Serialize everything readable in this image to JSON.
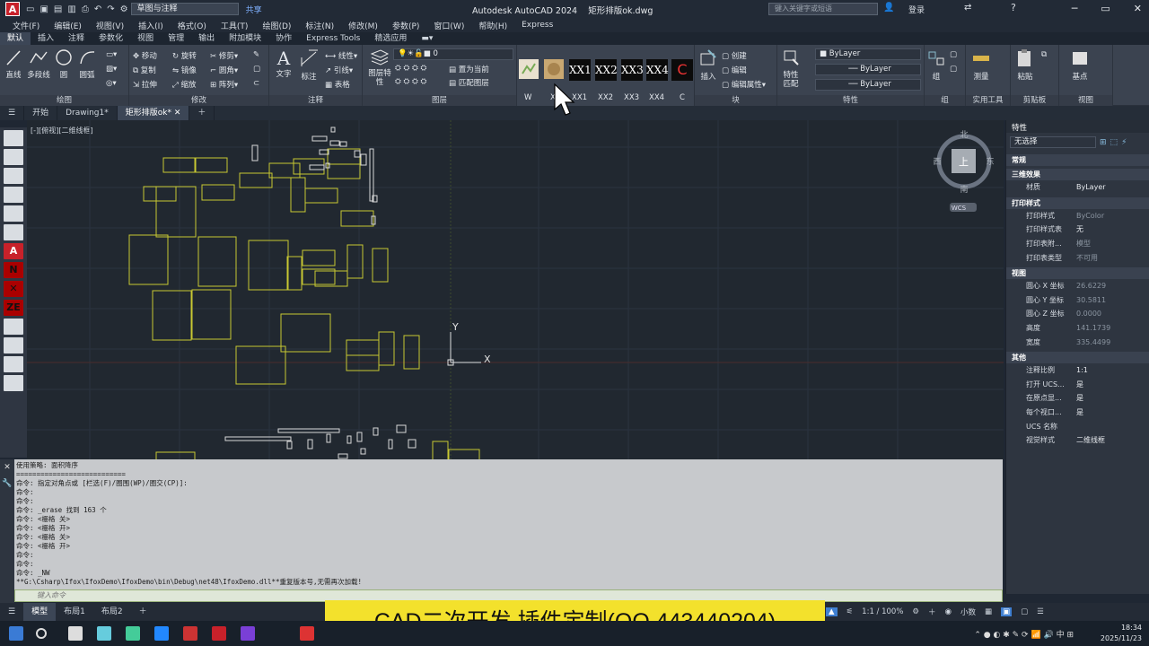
{
  "titlebar": {
    "workspace": "草图与注释",
    "share": "共享",
    "app_title": "Autodesk AutoCAD 2024",
    "file_name": "矩形排版ok.dwg",
    "search_placeholder": "键入关键字或短语",
    "login": "登录"
  },
  "menu": [
    "文件(F)",
    "编辑(E)",
    "视图(V)",
    "插入(I)",
    "格式(O)",
    "工具(T)",
    "绘图(D)",
    "标注(N)",
    "修改(M)",
    "参数(P)",
    "窗口(W)",
    "帮助(H)",
    "Express"
  ],
  "ribbon_tabs": [
    "默认",
    "插入",
    "注释",
    "参数化",
    "视图",
    "管理",
    "输出",
    "附加模块",
    "协作",
    "Express Tools",
    "精选应用"
  ],
  "ribbon": {
    "draw": {
      "label": "绘图",
      "buttons": [
        "直线",
        "多段线",
        "圆",
        "圆弧"
      ]
    },
    "modify": {
      "label": "修改",
      "buttons": [
        "移动",
        "旋转",
        "修剪",
        "复制",
        "镜像",
        "圆角",
        "拉伸",
        "缩放",
        "阵列"
      ]
    },
    "annotation": {
      "label": "注释",
      "buttons": [
        "文字",
        "标注",
        "线性",
        "引线",
        "表格"
      ]
    },
    "layers": {
      "label": "图层",
      "buttons": [
        "图层特性",
        "置为当前",
        "匹配图层"
      ],
      "current_layer": "0"
    },
    "custom": {
      "labels": [
        "W",
        "X",
        "XX1",
        "XX2",
        "XX3",
        "XX4",
        "C"
      ],
      "boxes": [
        "XX1",
        "XX2",
        "XX3",
        "XX4"
      ]
    },
    "block": {
      "label": "块",
      "buttons": [
        "插入",
        "创建",
        "编辑",
        "编辑属性"
      ]
    },
    "properties": {
      "label": "特性",
      "match": "特性匹配",
      "color": "ByLayer",
      "linetype": "ByLayer",
      "lineweight": "ByLayer"
    },
    "groups": {
      "label": "组",
      "buttons": [
        "组"
      ]
    },
    "utilities": {
      "label": "实用工具",
      "buttons": [
        "测量"
      ]
    },
    "clipboard": {
      "label": "剪贴板",
      "buttons": [
        "粘贴"
      ]
    },
    "view": {
      "label": "视图",
      "buttons": [
        "基点"
      ]
    }
  },
  "doc_tabs": [
    "开始",
    "Drawing1*",
    "矩形排版ok*"
  ],
  "viewport": {
    "label": "[-][俯视][二维线框]",
    "compass": {
      "n": "北",
      "s": "南",
      "e": "东",
      "w": "西",
      "top": "上",
      "wcs": "WCS"
    },
    "ucs_x": "X",
    "ucs_y": "Y"
  },
  "properties": {
    "title": "特性",
    "selection": "无选择",
    "sections": [
      {
        "name": "常规",
        "rows": []
      },
      {
        "name": "三维效果",
        "rows": [
          {
            "k": "材质",
            "v": "ByLayer",
            "dim": false
          }
        ]
      },
      {
        "name": "打印样式",
        "rows": [
          {
            "k": "打印样式",
            "v": "ByColor",
            "dim": true
          },
          {
            "k": "打印样式表",
            "v": "无",
            "dim": false
          },
          {
            "k": "打印表附...",
            "v": "模型",
            "dim": true
          },
          {
            "k": "打印表类型",
            "v": "不可用",
            "dim": true
          }
        ]
      },
      {
        "name": "视图",
        "rows": [
          {
            "k": "圆心 X 坐标",
            "v": "26.6229",
            "dim": true
          },
          {
            "k": "圆心 Y 坐标",
            "v": "30.5811",
            "dim": true
          },
          {
            "k": "圆心 Z 坐标",
            "v": "0.0000",
            "dim": true
          },
          {
            "k": "高度",
            "v": "141.1739",
            "dim": true
          },
          {
            "k": "宽度",
            "v": "335.4499",
            "dim": true
          }
        ]
      },
      {
        "name": "其他",
        "rows": [
          {
            "k": "注释比例",
            "v": "1:1",
            "dim": false
          },
          {
            "k": "打开 UCS...",
            "v": "是",
            "dim": false
          },
          {
            "k": "在原点显...",
            "v": "是",
            "dim": false
          },
          {
            "k": "每个视口...",
            "v": "是",
            "dim": false
          },
          {
            "k": "UCS 名称",
            "v": "",
            "dim": false
          },
          {
            "k": "视觉样式",
            "v": "二维线框",
            "dim": false
          }
        ]
      }
    ]
  },
  "command": {
    "lines": [
      "使用策略: 面积降序",
      "===========================",
      "命令: 指定对角点或 [栏选(F)/圈围(WP)/圈交(CP)]:",
      "命令:",
      "命令:",
      "命令: _erase 找到 163 个",
      "命令: <栅格 关>",
      "命令: <栅格 开>",
      "命令: <栅格 关>",
      "命令: <栅格 开>",
      "命令:",
      "命令:",
      "命令: _NW",
      "**G:\\Csharp\\Ifox\\IfoxDemo\\IfoxDemo\\bin\\Debug\\net48\\IfoxDemo.dll**重复版本号,无需再次加载!"
    ],
    "input_placeholder": "键入命令"
  },
  "layout_tabs": [
    "模型",
    "布局1",
    "布局2"
  ],
  "status": {
    "scale": "1:1 / 100%",
    "units": "小数"
  },
  "banner": "CAD二次开发 插件定制(QQ 443440204)",
  "taskbar": {
    "time": "18:34",
    "date": "2025/11/23",
    "ime": "中"
  }
}
